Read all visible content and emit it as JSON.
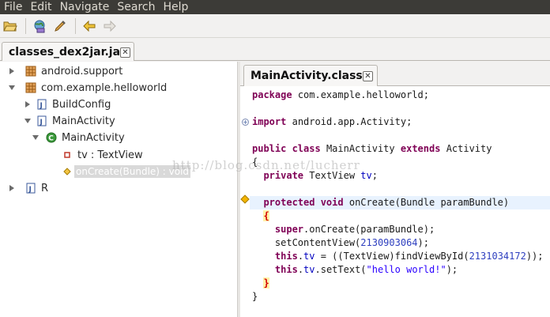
{
  "menu": [
    "File",
    "Edit",
    "Navigate",
    "Search",
    "Help"
  ],
  "toolbar": {
    "icons": [
      "open-folder-icon",
      "save-globe-icon",
      "edit-brush-icon",
      "back-arrow-icon",
      "forward-arrow-icon"
    ]
  },
  "outer_tab": {
    "label": "classes_dex2jar.jar",
    "close": "✕"
  },
  "tree": {
    "items": [
      {
        "label": "android.support",
        "icon": "package-icon",
        "expanded": false
      },
      {
        "label": "com.example.helloworld",
        "icon": "package-icon",
        "expanded": true
      },
      {
        "label": "BuildConfig",
        "icon": "java-file-icon",
        "expanded": false
      },
      {
        "label": "MainActivity",
        "icon": "java-file-icon",
        "expanded": true
      },
      {
        "label": "MainActivity",
        "icon": "class-icon",
        "expanded": true
      },
      {
        "label": "tv : TextView",
        "icon": "private-field-icon"
      },
      {
        "label": "onCreate(Bundle) : void",
        "icon": "protected-method-icon",
        "selected": true
      },
      {
        "label": "R",
        "icon": "java-file-icon",
        "expanded": false
      }
    ]
  },
  "editor_tab": {
    "label": "MainActivity.class",
    "close": "✕"
  },
  "code": {
    "lines": [
      "package com.example.helloworld;",
      "",
      "import android.app.Activity;",
      "",
      "public class MainActivity extends Activity",
      "{",
      "  private TextView tv;",
      "",
      "  protected void onCreate(Bundle paramBundle)",
      "  {",
      "    super.onCreate(paramBundle);",
      "    setContentView(2130903064);",
      "    this.tv = ((TextView)findViewById(2131034172));",
      "    this.tv.setText(\"hello world!\");",
      "  }",
      "}"
    ]
  },
  "watermark": "http://blog.csdn.net/lucherr",
  "colors": {
    "keyword": "#7f0055",
    "field": "#0000c0",
    "string": "#2a00ff",
    "menubar": "#3c3b37",
    "selection": "#d9d9d9"
  }
}
